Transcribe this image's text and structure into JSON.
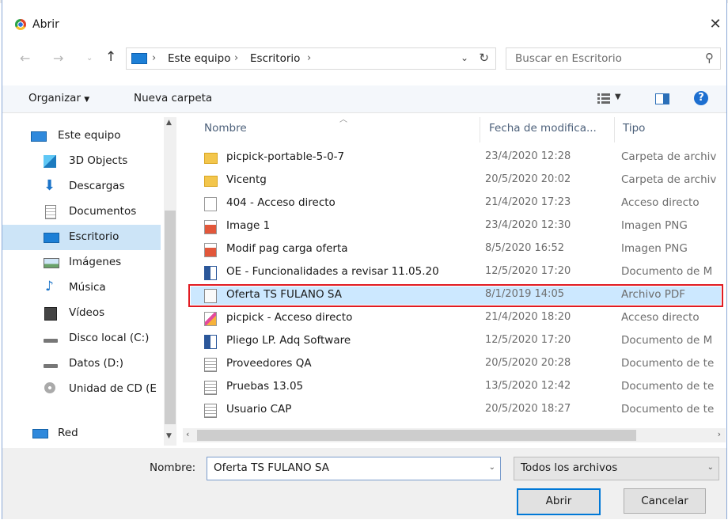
{
  "window": {
    "title": "Abrir"
  },
  "nav": {
    "breadcrumbs": [
      "Este equipo",
      "Escritorio"
    ],
    "search_placeholder": "Buscar en Escritorio"
  },
  "toolbar": {
    "organize": "Organizar",
    "new_folder": "Nueva carpeta"
  },
  "sidebar": {
    "items": [
      {
        "label": "Este equipo",
        "icon": "computer-icon"
      },
      {
        "label": "3D Objects",
        "icon": "3d-objects-icon"
      },
      {
        "label": "Descargas",
        "icon": "download-icon"
      },
      {
        "label": "Documentos",
        "icon": "documents-icon"
      },
      {
        "label": "Escritorio",
        "icon": "desktop-icon",
        "selected": true
      },
      {
        "label": "Imágenes",
        "icon": "pictures-icon"
      },
      {
        "label": "Música",
        "icon": "music-icon"
      },
      {
        "label": "Vídeos",
        "icon": "videos-icon"
      },
      {
        "label": "Disco local (C:)",
        "icon": "drive-icon"
      },
      {
        "label": "Datos (D:)",
        "icon": "drive-icon"
      },
      {
        "label": "Unidad de CD (E",
        "icon": "cd-drive-icon"
      },
      {
        "label": "Red",
        "icon": "network-icon"
      }
    ]
  },
  "list": {
    "columns": {
      "name": "Nombre",
      "date": "Fecha de modifica...",
      "type": "Tipo"
    },
    "rows": [
      {
        "name": "picpick-portable-5-0-7",
        "date": "23/4/2020 12:28",
        "type": "Carpeta de archiv",
        "icon": "folder-icon"
      },
      {
        "name": "Vicentg",
        "date": "20/5/2020 20:02",
        "type": "Carpeta de archiv",
        "icon": "folder-icon"
      },
      {
        "name": "404 - Acceso directo",
        "date": "21/4/2020 17:23",
        "type": "Acceso directo",
        "icon": "shortcut-icon"
      },
      {
        "name": "Image 1",
        "date": "23/4/2020 12:30",
        "type": "Imagen PNG",
        "icon": "image-file-icon"
      },
      {
        "name": "Modif pag carga oferta",
        "date": "8/5/2020 16:52",
        "type": "Imagen PNG",
        "icon": "image-file-icon"
      },
      {
        "name": "OE - Funcionalidades a revisar 11.05.20",
        "date": "12/5/2020 17:20",
        "type": "Documento de M",
        "icon": "word-doc-icon"
      },
      {
        "name": "Oferta TS FULANO SA",
        "date": "8/1/2019 14:05",
        "type": "Archivo PDF",
        "icon": "pdf-file-icon",
        "selected": true
      },
      {
        "name": "picpick - Acceso directo",
        "date": "21/4/2020 18:20",
        "type": "Acceso directo",
        "icon": "shortcut-icon"
      },
      {
        "name": "Pliego LP. Adq Software",
        "date": "12/5/2020 17:20",
        "type": "Documento de M",
        "icon": "word-doc-icon"
      },
      {
        "name": "Proveedores QA",
        "date": "20/5/2020 20:28",
        "type": "Documento de te",
        "icon": "text-file-icon"
      },
      {
        "name": "Pruebas 13.05",
        "date": "13/5/2020 12:42",
        "type": "Documento de te",
        "icon": "text-file-icon"
      },
      {
        "name": "Usuario CAP",
        "date": "20/5/2020 18:27",
        "type": "Documento de te",
        "icon": "text-file-icon"
      }
    ]
  },
  "bottom": {
    "name_label": "Nombre:",
    "name_value": "Oferta TS FULANO SA",
    "type_value": "Todos los archivos",
    "open_label": "Abrir",
    "cancel_label": "Cancelar"
  },
  "colors": {
    "selected_bg": "#cce8ff",
    "highlight_box": "#e11b22",
    "accent": "#0078d7"
  }
}
